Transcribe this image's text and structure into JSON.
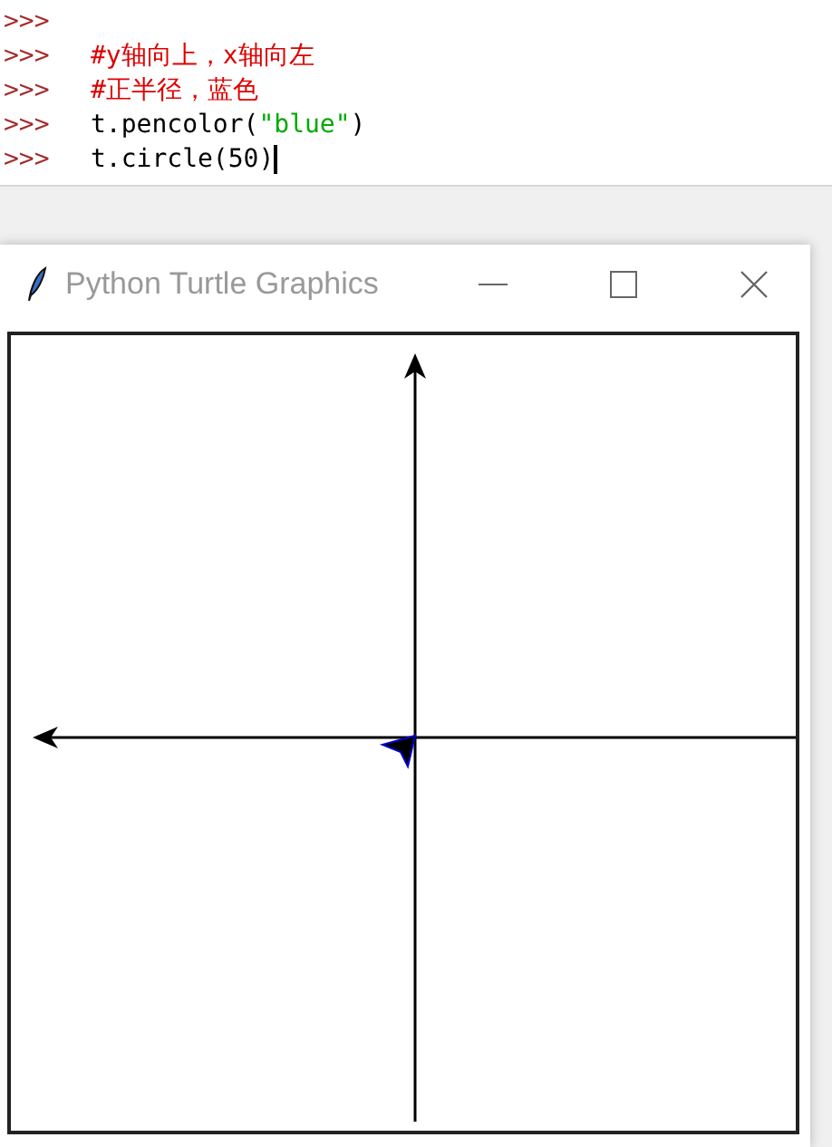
{
  "shell": {
    "lines": [
      {
        "prompt": ">>>"
      },
      {
        "prompt": ">>>",
        "parts": [
          {
            "text": "#y轴向上，x轴向左",
            "kind": "comment"
          }
        ]
      },
      {
        "prompt": ">>>",
        "parts": [
          {
            "text": "#正半径，蓝色",
            "kind": "comment"
          }
        ]
      },
      {
        "prompt": ">>>",
        "parts": [
          {
            "text": "t.pencolor(",
            "kind": "code"
          },
          {
            "text": "\"blue\"",
            "kind": "string"
          },
          {
            "text": ")",
            "kind": "code"
          }
        ]
      },
      {
        "prompt": ">>>",
        "parts": [
          {
            "text": "t.circle(50)",
            "kind": "code"
          }
        ],
        "cursor": true
      }
    ]
  },
  "window": {
    "title": "Python Turtle Graphics"
  }
}
